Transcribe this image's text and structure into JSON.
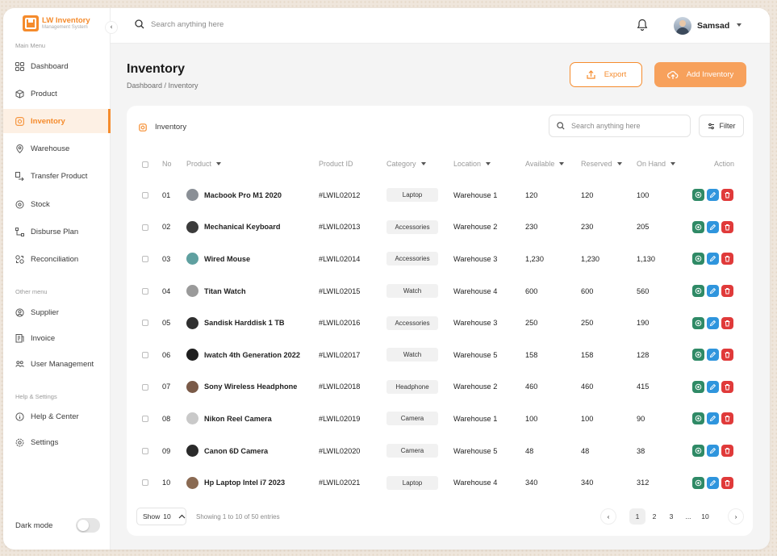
{
  "brand": {
    "title": "LW Inventory",
    "subtitle": "Management System"
  },
  "sidebar": {
    "main_label": "Main Menu",
    "main_items": [
      {
        "label": "Dashboard",
        "icon": "grid-icon"
      },
      {
        "label": "Product",
        "icon": "box-icon"
      },
      {
        "label": "Inventory",
        "icon": "inventory-icon",
        "active": true
      },
      {
        "label": "Warehouse",
        "icon": "location-pin-icon"
      },
      {
        "label": "Transfer Product",
        "icon": "transfer-icon"
      },
      {
        "label": "Stock",
        "icon": "target-icon"
      },
      {
        "label": "Disburse Plan",
        "icon": "flow-icon"
      },
      {
        "label": "Reconciliation",
        "icon": "reconcile-icon"
      }
    ],
    "other_label": "Other menu",
    "other_items": [
      {
        "label": "Supplier",
        "icon": "user-circle-icon"
      },
      {
        "label": "Invoice",
        "icon": "invoice-icon"
      },
      {
        "label": "User Management",
        "icon": "users-icon"
      }
    ],
    "help_label": "Help & Settings",
    "help_items": [
      {
        "label": "Help & Center",
        "icon": "info-icon"
      },
      {
        "label": "Settings",
        "icon": "gear-icon"
      }
    ],
    "dark_mode": "Dark mode"
  },
  "topbar": {
    "search_placeholder": "Search anything here",
    "user": "Samsad"
  },
  "page": {
    "title": "Inventory",
    "breadcrumb": "Dashboard / Inventory",
    "export_label": "Export",
    "add_label": "Add Inventory"
  },
  "table": {
    "title": "Inventory",
    "search_placeholder": "Search anything here",
    "filter_label": "Filter",
    "headers": {
      "no": "No",
      "product": "Product",
      "product_id": "Product ID",
      "category": "Category",
      "location": "Location",
      "available": "Available",
      "reserved": "Reserved",
      "on_hand": "On Hand",
      "action": "Action"
    },
    "rows": [
      {
        "no": "01",
        "product": "Macbook Pro M1 2020",
        "id": "#LWIL02012",
        "category": "Laptop",
        "location": "Warehouse 1",
        "available": "120",
        "reserved": "120",
        "on_hand": "100",
        "thumb": "#8a8f96"
      },
      {
        "no": "02",
        "product": "Mechanical Keyboard",
        "id": "#LWIL02013",
        "category": "Accessories",
        "location": "Warehouse 2",
        "available": "230",
        "reserved": "230",
        "on_hand": "205",
        "thumb": "#3b3b3b"
      },
      {
        "no": "03",
        "product": "Wired Mouse",
        "id": "#LWIL02014",
        "category": "Accessories",
        "location": "Warehouse 3",
        "available": "1,230",
        "reserved": "1,230",
        "on_hand": "1,130",
        "thumb": "#5fa0a0"
      },
      {
        "no": "04",
        "product": "Titan Watch",
        "id": "#LWIL02015",
        "category": "Watch",
        "location": "Warehouse 4",
        "available": "600",
        "reserved": "600",
        "on_hand": "560",
        "thumb": "#9a9a9a"
      },
      {
        "no": "05",
        "product": "Sandisk Harddisk 1 TB",
        "id": "#LWIL02016",
        "category": "Accessories",
        "location": "Warehouse 3",
        "available": "250",
        "reserved": "250",
        "on_hand": "190",
        "thumb": "#2f2f2f"
      },
      {
        "no": "06",
        "product": "Iwatch 4th Generation 2022",
        "id": "#LWIL02017",
        "category": "Watch",
        "location": "Warehouse 5",
        "available": "158",
        "reserved": "158",
        "on_hand": "128",
        "thumb": "#1e1e1e"
      },
      {
        "no": "07",
        "product": "Sony Wireless Headphone",
        "id": "#LWIL02018",
        "category": "Headphone",
        "location": "Warehouse 2",
        "available": "460",
        "reserved": "460",
        "on_hand": "415",
        "thumb": "#7a5a48"
      },
      {
        "no": "08",
        "product": "Nikon Reel Camera",
        "id": "#LWIL02019",
        "category": "Camera",
        "location": "Warehouse 1",
        "available": "100",
        "reserved": "100",
        "on_hand": "90",
        "thumb": "#c9c9c9"
      },
      {
        "no": "09",
        "product": "Canon 6D Camera",
        "id": "#LWIL02020",
        "category": "Camera",
        "location": "Warehouse 5",
        "available": "48",
        "reserved": "48",
        "on_hand": "38",
        "thumb": "#2a2a2a"
      },
      {
        "no": "10",
        "product": "Hp Laptop Intel i7 2023",
        "id": "#LWIL02021",
        "category": "Laptop",
        "location": "Warehouse 4",
        "available": "340",
        "reserved": "340",
        "on_hand": "312",
        "thumb": "#8a6a52"
      }
    ],
    "footer": {
      "show_label": "Show",
      "show_value": "10",
      "showing": "Showing 1 to 10 of 50 entries",
      "pages": [
        "1",
        "2",
        "3",
        "...",
        "10"
      ]
    }
  },
  "colors": {
    "accent": "#f58b2c",
    "view": "#2f8a66",
    "edit": "#2f95dd",
    "delete": "#e03a3a"
  }
}
